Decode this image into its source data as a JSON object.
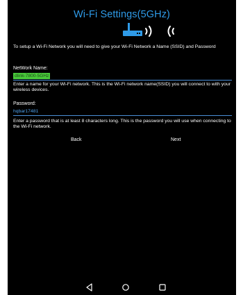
{
  "screen": {
    "title": "Wi-Fi Settings(5GHz)",
    "intro_text": "To setup a Wi-Fi Network you will need to give your Wi-Fi Network a Name (SSID) and Password"
  },
  "network_name": {
    "label": "NetWork Name:",
    "value": "dlink-7800-5GHz",
    "help": "Enter a name for your Wi-Fi network. This is the Wi-Fi network name(SSID) you will connect to with your wireless devices."
  },
  "password": {
    "label": "Password:",
    "value": "hqbar17481",
    "help": "Enter a password that is at least 8 characters long. This is the password you will use when connecting to the Wi-Fi network."
  },
  "actions": {
    "back_label": "Back",
    "next_label": "Next"
  },
  "icons": {
    "router": "router-icon",
    "signal_right": "wifi-signal-right-icon",
    "signal_left": "wifi-signal-left-icon",
    "nav_back": "nav-back-triangle-icon",
    "nav_home": "nav-home-circle-icon",
    "nav_recents": "nav-recents-square-icon"
  },
  "colors": {
    "background": "#000000",
    "title": "#2f9be8",
    "accent_line": "#4a8fd8",
    "ssid_highlight": "#48c93a",
    "password_text": "#4fa3f0"
  }
}
